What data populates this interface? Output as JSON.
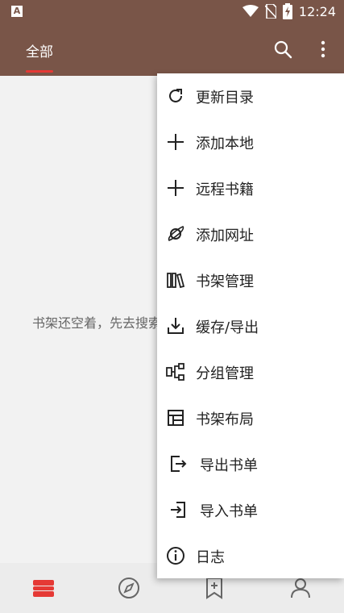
{
  "status": {
    "time": "12:24",
    "left_icon": "A"
  },
  "appbar": {
    "tab_all": "全部"
  },
  "empty_message": "书架还空着，先去搜索书籍吧",
  "menu": {
    "items": [
      {
        "label": "更新目录",
        "icon": "refresh-icon"
      },
      {
        "label": "添加本地",
        "icon": "plus-icon"
      },
      {
        "label": "远程书籍",
        "icon": "plus-icon"
      },
      {
        "label": "添加网址",
        "icon": "planet-icon"
      },
      {
        "label": "书架管理",
        "icon": "books-icon"
      },
      {
        "label": "缓存/导出",
        "icon": "download-icon"
      },
      {
        "label": "分组管理",
        "icon": "group-icon"
      },
      {
        "label": "书架布局",
        "icon": "layout-icon"
      },
      {
        "label": "导出书单",
        "icon": "export-icon"
      },
      {
        "label": "导入书单",
        "icon": "import-icon"
      },
      {
        "label": "日志",
        "icon": "info-icon"
      }
    ]
  },
  "colors": {
    "primary": "#795548",
    "accent": "#e53935"
  }
}
